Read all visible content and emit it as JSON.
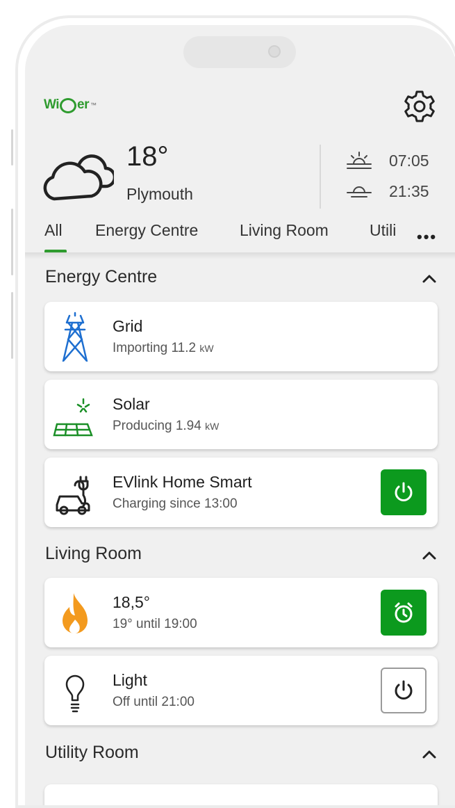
{
  "header": {
    "logo_text_left": "Wi",
    "logo_text_right": "er",
    "logo_tm": "™"
  },
  "weather": {
    "temperature": "18°",
    "location": "Plymouth",
    "sunrise": "07:05",
    "sunset": "21:35"
  },
  "tabs": [
    {
      "label": "All",
      "active": true
    },
    {
      "label": "Energy Centre"
    },
    {
      "label": "Living Room"
    },
    {
      "label": "Utili"
    }
  ],
  "more_label": "•••",
  "sections": {
    "energy_centre": {
      "title": "Energy Centre",
      "cards": {
        "grid": {
          "name": "Grid",
          "status": "Importing 11.2",
          "unit": "kW"
        },
        "solar": {
          "name": "Solar",
          "status": "Producing 1.94",
          "unit": "kW"
        },
        "ev": {
          "name": "EVlink Home Smart",
          "status": "Charging since 13:00"
        }
      }
    },
    "living_room": {
      "title": "Living Room",
      "cards": {
        "heating": {
          "name": "18,5°",
          "status": "19° until 19:00"
        },
        "light": {
          "name": "Light",
          "status": "Off until 21:00"
        }
      }
    },
    "utility_room": {
      "title": "Utility Room"
    }
  },
  "colors": {
    "brand_green": "#2e9b2e",
    "button_green": "#0c9a1e",
    "grid_blue": "#1e6fd0",
    "flame_orange": "#f39a1e"
  }
}
